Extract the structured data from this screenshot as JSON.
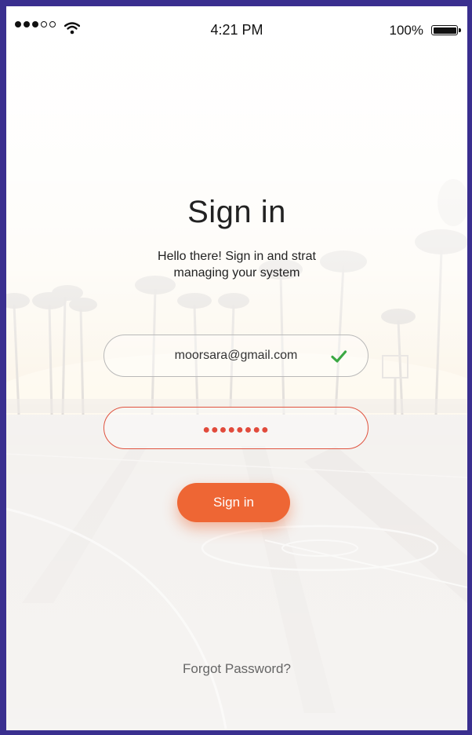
{
  "status_bar": {
    "time": "4:21 PM",
    "battery_percent": "100%",
    "signal_bars_filled": 3,
    "signal_bars_total": 5
  },
  "title": "Sign in",
  "subtitle_line1": "Hello there! Sign in and strat",
  "subtitle_line2": "managing your system",
  "email_field": {
    "value": "moorsara@gmail.com",
    "status_icon": "checkmark-icon",
    "status_color": "#3aa843"
  },
  "password_field": {
    "masked_value": "●●●●●●●●",
    "error_color": "#e14a3b"
  },
  "signin_button_label": "Sign in",
  "forgot_password_label": "Forgot Password?",
  "colors": {
    "accent": "#ee6634",
    "frame": "#3a2f8f"
  }
}
